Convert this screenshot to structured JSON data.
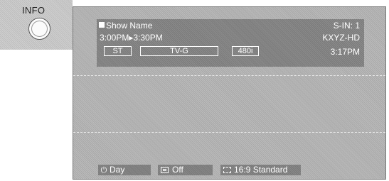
{
  "remote": {
    "button_label": "INFO",
    "button_icon": "round-button-icon"
  },
  "banner": {
    "show_name": "Show Name",
    "time_range": "3:00PM▸3:30PM",
    "input": "S-IN: 1",
    "station": "KXYZ-HD",
    "clock": "3:17PM",
    "tags": {
      "audio": "ST",
      "rating": "TV-G",
      "resolution": "480i"
    }
  },
  "status_bar": {
    "sleep": {
      "icon": "sleep-timer-icon",
      "glyph": "⏻",
      "label": "Day"
    },
    "caption": {
      "icon": "closed-caption-icon",
      "label": "Off"
    },
    "aspect": {
      "icon": "aspect-ratio-icon",
      "label": "16:9 Standard"
    }
  }
}
